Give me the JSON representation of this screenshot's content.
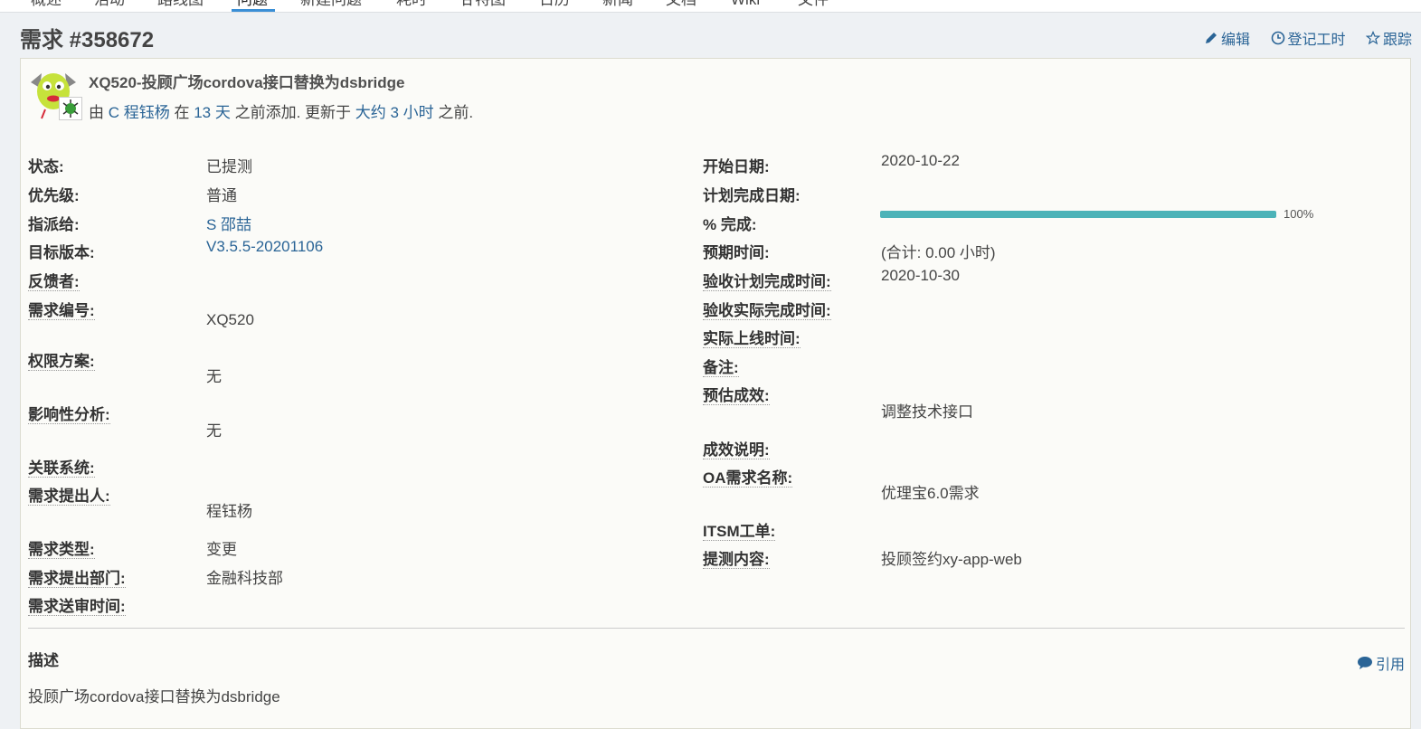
{
  "tabs": [
    "概述",
    "活动",
    "路线图",
    "问题",
    "新建问题",
    "耗时",
    "甘特图",
    "日历",
    "新闻",
    "文档",
    "Wiki",
    "文件"
  ],
  "issue": {
    "heading": "需求 #358672",
    "subject": "XQ520-投顾广场cordova接口替换为dsbridge",
    "meta": {
      "by_prefix": "由",
      "author": "C 程钰杨",
      "at": "在",
      "created_ago": "13 天",
      "added_text": "之前添加. 更新于",
      "updated_ago": "大约 3 小时",
      "suffix": "之前."
    }
  },
  "actions": {
    "edit": "编辑",
    "log_time": "登记工时",
    "watch": "跟踪"
  },
  "left_attrs": [
    {
      "label": "状态:",
      "value": "已提测"
    },
    {
      "label": "优先级:",
      "value": "普通"
    },
    {
      "label": "指派给:",
      "value": "S 邵喆"
    },
    {
      "label": "目标版本:",
      "value": "V3.5.5-20201106"
    },
    {
      "label": "反馈者:",
      "value": ""
    },
    {
      "label": "需求编号:",
      "value": "XQ520"
    },
    {
      "label": "权限方案:",
      "value": "无"
    },
    {
      "label": "影响性分析:",
      "value": "无"
    },
    {
      "label": "关联系统:",
      "value": ""
    },
    {
      "label": "需求提出人:",
      "value": "程钰杨"
    },
    {
      "label": "需求类型:",
      "value": "变更"
    },
    {
      "label": "需求提出部门:",
      "value": "金融科技部"
    },
    {
      "label": "需求送审时间:",
      "value": ""
    }
  ],
  "right_attrs": [
    {
      "label": "开始日期:",
      "value": "2020-10-22"
    },
    {
      "label": "计划完成日期:",
      "value": ""
    },
    {
      "label": "% 完成:",
      "value": ""
    },
    {
      "label": "预期时间:",
      "value": "(合计: 0.00 小时)"
    },
    {
      "label": "验收计划完成时间:",
      "value": "2020-10-30"
    },
    {
      "label": "验收实际完成时间:",
      "value": ""
    },
    {
      "label": "实际上线时间:",
      "value": ""
    },
    {
      "label": "备注:",
      "value": ""
    },
    {
      "label": "预估成效:",
      "value": "调整技术接口"
    },
    {
      "label": "成效说明:",
      "value": ""
    },
    {
      "label": "OA需求名称:",
      "value": "优理宝6.0需求"
    },
    {
      "label": "ITSM工单:",
      "value": ""
    },
    {
      "label": "提测内容:",
      "value": "投顾签约xy-app-web"
    }
  ],
  "progress": {
    "percent": 100,
    "label": "100%",
    "color": "#4cb3b8"
  },
  "description": {
    "title": "描述",
    "quote": "引用",
    "body": "投顾广场cordova接口替换为dsbridge"
  },
  "icons": {
    "edit": "pencil-icon",
    "log_time": "clock-icon",
    "watch": "star-icon",
    "quote": "speech-bubble-icon"
  }
}
